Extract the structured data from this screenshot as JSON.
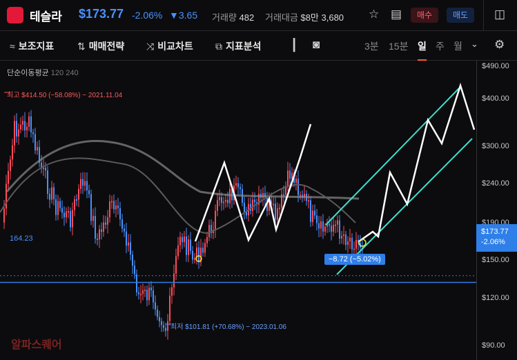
{
  "header": {
    "title": "테슬라",
    "price": "$173.77",
    "change_pct": "-2.06%",
    "change_abs": "▼3.65",
    "volume_label": "거래량",
    "volume_value": "482",
    "amount_label": "거래대금",
    "amount_value": "$8만 3,680",
    "buy_label": "매수",
    "sell_label": "매도",
    "icons": [
      "tesla-logo",
      "star-icon",
      "clipboard-icon",
      "sidebar-icon"
    ]
  },
  "toolbar": {
    "items": [
      {
        "label": "보조지표",
        "icon": "indicator-icon"
      },
      {
        "label": "매매전략",
        "icon": "strategy-icon"
      },
      {
        "label": "비교차트",
        "icon": "compare-icon"
      },
      {
        "label": "지표분석",
        "icon": "analysis-icon"
      }
    ],
    "periods": [
      "3분",
      "15분",
      "일",
      "주",
      "월"
    ],
    "active_period": "일",
    "icons": [
      "candle-icon",
      "camera-icon",
      "chevron-down-icon",
      "settings-icon"
    ]
  },
  "chart_data": {
    "type": "candlestick",
    "indicator": {
      "label": "단순이동평균",
      "periods": [
        "120",
        "240"
      ]
    },
    "y_scale": "log",
    "y_ticks": [
      "$490.00",
      "$400.00",
      "$300.00",
      "$240.00",
      "$190.00",
      "$150.00",
      "$120.00",
      "$90.00"
    ],
    "y_tick_values": [
      490,
      400,
      300,
      240,
      190,
      150,
      120,
      90
    ],
    "current": {
      "price": "$173.77",
      "pct": "-2.06%",
      "value": 173.77
    },
    "horizontal_level": {
      "label": "164.23",
      "value": 164.23
    },
    "high_annotation": {
      "text": "최고 $414.50 (−58.08%) − 2021.11.04",
      "value": 414.5
    },
    "low_annotation": {
      "text": "최저 $101.81 (+70.68%) − 2023.01.06",
      "value": 101.81
    },
    "delta_label": "−8.72  (−5.02%)",
    "colors": {
      "up": "#ff4d5a",
      "down": "#4a90ff",
      "channel": "#40e0d0",
      "level": "#2f7fe8",
      "drawing": "#ffffff",
      "ma": "#8a8a8a"
    }
  },
  "watermark": "알파스퀘어"
}
